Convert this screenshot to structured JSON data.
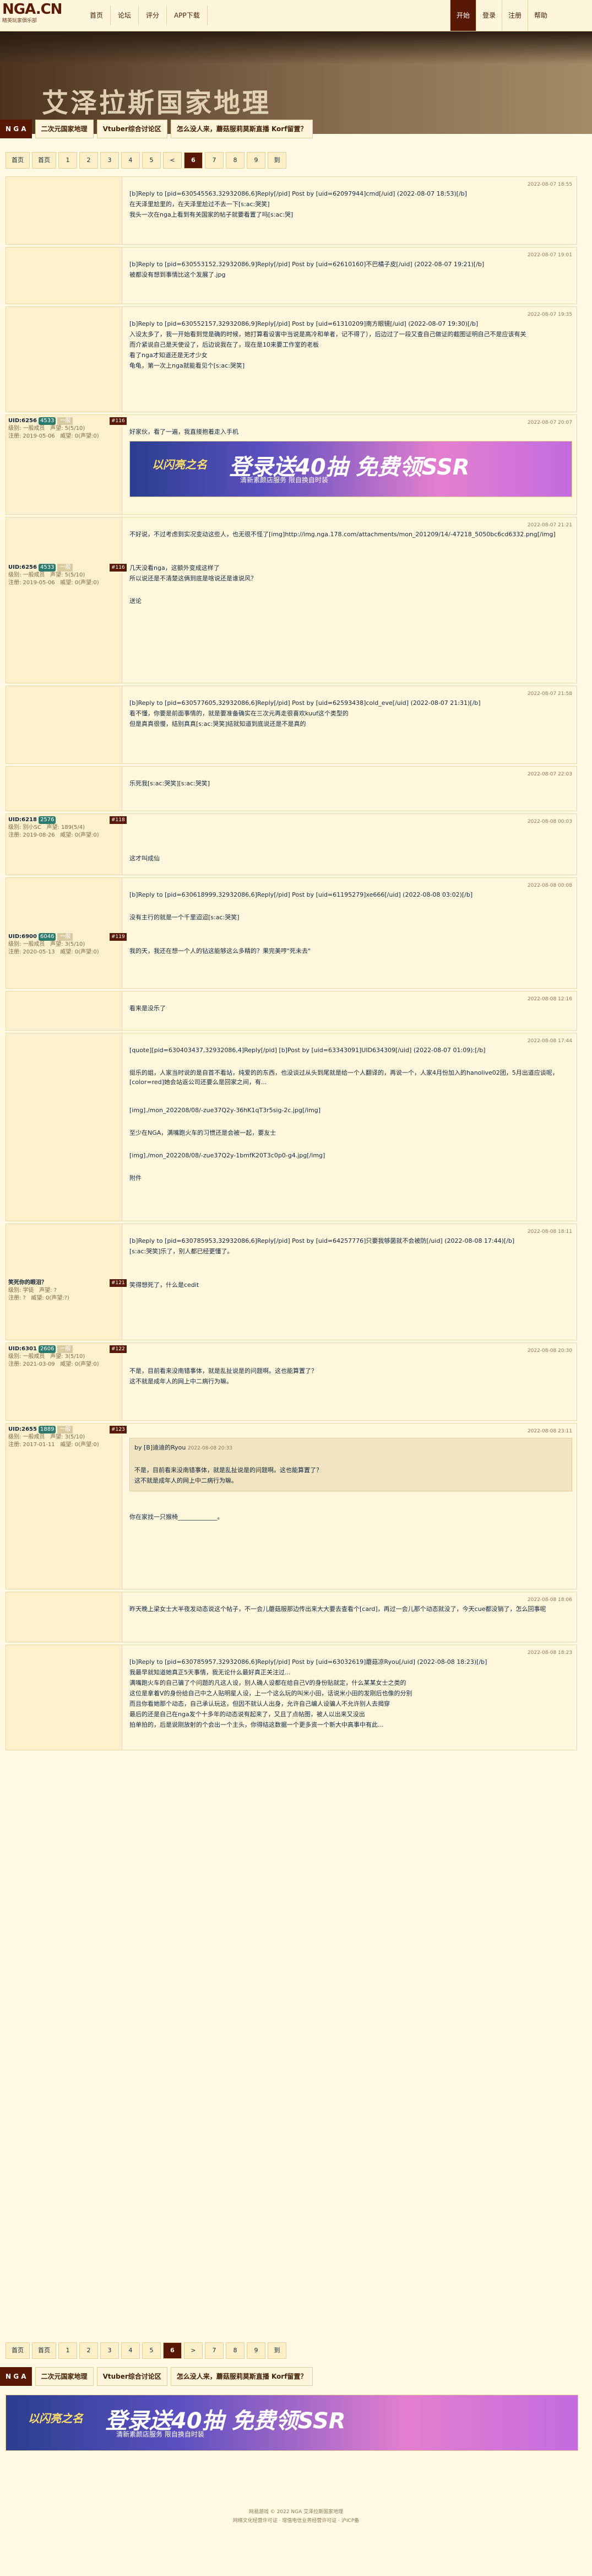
{
  "site": {
    "logo": "NGA.CN",
    "logo_sub": "精英玩家俱乐部"
  },
  "nav": [
    "首页",
    "论坛",
    "评分",
    "APP下载"
  ],
  "right_nav": [
    "开始",
    "登录",
    "注册",
    "帮助"
  ],
  "banner_title": "艾泽拉斯国家地理",
  "catbar": {
    "home": "N G A",
    "tabs": [
      "二次元国家地理",
      "Vtuber综合讨论区",
      "怎么没人来，蘑菇服莉莫斯直播 Korf留置？"
    ]
  },
  "pager": [
    "首页",
    "首页",
    "1",
    "2",
    "3",
    "4",
    "5",
    "<",
    "6",
    "7",
    "8",
    "9",
    "到"
  ],
  "pager_bottom": [
    "首页",
    "首页",
    "1",
    "2",
    "3",
    "4",
    "5",
    "6",
    ">",
    "7",
    "8",
    "9",
    "到"
  ],
  "ad": {
    "logo": "以闪亮之名",
    "headline": "登录送40抽 免费领SSR",
    "sub": "清新素颜店服务 限自换自时装"
  },
  "posts": [
    {
      "time": "2022-08-07 18:55",
      "lines": [
        "[b]Reply to [pid=630545563,32932086,6]Reply[/pid] Post by [uid=62097944]cmd[/uid] (2022-08-07 18:53)[/b]",
        "在天泽里尬里的，在天泽里尬过不去一下[s:ac:哭笑]",
        "我头一次在nga上看到有关国家的帖子就要看置了吗[s:ac:哭]"
      ]
    },
    {
      "time": "2022-08-07 19:01",
      "lines": [
        "[b]Reply to [pid=630553152,32932086,9]Reply[/pid] Post by [uid=62610160]不巴橘子皮[/uid] (2022-08-07 19:21)[/b]",
        "被都没有想到事情比这个发展了.jpg"
      ]
    },
    {
      "time": "2022-08-07 19:35",
      "lines": [
        "[b]Reply to [pid=630552157,32932086,9]Reply[/pid] Post by [uid=61310209]南方眼镜[/uid] (2022-08-07 19:30)[/b]",
        "入设太多了，我一开始看到觉是确的时候，她打算看设害中当说是高冷和单者，记不得了），后边过了一段又查自己做证的截图证明自己不是应该有关",
        "而介紧说自己是天使设了，后边说我在了，现在是10来要工作室的老板",
        "看了nga才知道还是无才少女",
        "龟龟，第一次上nga就能看见个[s:ac:哭笑]"
      ]
    },
    {
      "time": "2022-08-07 20:07",
      "user": {
        "name": "UID:6256",
        "lvl": "4533",
        "tag": "一般",
        "level": "级别: 一般成员",
        "prestige": "声望: 5(5/10)",
        "money": "注册: 2019-05-06",
        "credit": "威望: 0(声望:0)",
        "floor": "#116"
      },
      "lines": [
        "好家伙，看了一遍，我直接抱着走入手机"
      ]
    },
    {
      "time": "2022-08-07 21:21",
      "user": {
        "name": "UID:6256",
        "lvl": "4533",
        "tag": "一般",
        "level": "级别: 一般成员",
        "prestige": "声望: 5(5/10)",
        "money": "注册: 2019-05-06",
        "credit": "威望: 0(声望:0)",
        "floor": "#116"
      },
      "lines": [
        "不好说，不过考虑到实况变动这些人，也无很不怪了[img]http://img.nga.178.com/attachments/mon_201209/14/-47218_5050bc6cd6332.png[/img]",
        "几天没看nga，这额外变成这样了",
        "所以说还是不清楚这俩到底是啥说还是谁说风？"
      ],
      "extra": "送论"
    },
    {
      "time": "2022-08-07 21:58",
      "lines": [
        "[b]Reply to [pid=630577605,32932086,6]Reply[/pid] Post by [uid=62593438]cold_eve[/uid] (2022-08-07 21:31)[/b]",
        "看不懂，你要是前面事情的，就是要准备确实在三次元再走很喜欢kuuf这个类型的",
        "但是真真很慢，结别真真[s:ac:哭笑]结就知道到底说还是不是真的"
      ]
    },
    {
      "time": "2022-08-07 22:03",
      "lines": [
        "乐死我[s:ac:哭笑][s:ac:哭笑]"
      ]
    },
    {
      "time": "2022-08-08 00:03",
      "user": {
        "name": "UID:6218",
        "lvl": "2576",
        "tag": "",
        "level": "级别: 别小SC",
        "prestige": "声望: 189(5/4)",
        "money": "注册: 2019-08-26",
        "credit": "威望: 0(声望:0)",
        "floor": "#118"
      },
      "lines": [
        "这才叫成仙"
      ]
    },
    {
      "time": "2022-08-08 00:08",
      "user": {
        "name": "UID:6900",
        "lvl": "6046",
        "tag": "一般",
        "level": "级别: 一般成员",
        "prestige": "声望: 3(5/10)",
        "money": "注册: 2020-05-13",
        "credit": "威望: 0(声望:0)",
        "floor": "#119"
      },
      "lines": [
        "[b]Reply to [pid=630618999,32932086,6]Reply[/pid] Post by [uid=61195279]xe666[/uid] (2022-08-08 03:02)[/b]",
        "没有主行的就是一个千里迢迢[s:ac:哭笑]",
        "我的天，我还在想一个人的钻这能够这么多精的？果完美哼\"死未去\""
      ]
    },
    {
      "time": "2022-08-08 12:16",
      "lines": [
        "看来是没乐了"
      ]
    },
    {
      "time": "2022-08-08 17:44",
      "lines": [
        "[quote][pid=630403437,32932086,4]Reply[/pid] [b]Post by [uid=63343091]UID634309[/uid] (2022-08-07 01:09):[/b]",
        "挺乐的姐，人家当时说的是自首不看站，纯爱的的东西，也没谈过从头到尾就是给一个人翻译的，再说一个，人家4月份加入的hanolive02团，5月出道应谈呢，[color=red]她会站返公司还要么是回家之间，有...",
        "[img]./mon_202208/08/-zue37Q2y-36hK1qT3r5sig-2c.jpg[/img]",
        "至少在NGA，满嘴跑火车的习惯还是会被一起，要友士",
        "[img]./mon_202208/08/-zue37Q2y-1bmfK20T3c0p0-g4.jpg[/img]",
        "附件"
      ]
    },
    {
      "time": "2022-08-08 18:11",
      "user": {
        "name": "笑死你的眼泪？",
        "lvl": "",
        "tag": "",
        "level": "级别: 学徒",
        "prestige": "声望: ?",
        "money": "注册: ?",
        "credit": "威望: 0(声望:?)",
        "floor": "#121"
      },
      "lines": [
        "[b]Reply to [pid=630785953,32932086,6]Reply[/pid] Post by [uid=64257776]只要我够菌就不会被防[/uid] (2022-08-08 17:44)[/b]",
        "[s:ac:哭笑]乐了，别人都已经更懂了。",
        "笑得想死了，什么是cedit"
      ]
    },
    {
      "time": "2022-08-08 20:30",
      "user": {
        "name": "UID:6301",
        "lvl": "2606",
        "tag": "一般",
        "level": "级别: 一般成员",
        "prestige": "声望: 3(5/10)",
        "money": "注册: 2021-03-09",
        "credit": "威望: 0(声望:0)",
        "floor": "#122"
      },
      "lines": [
        "不是，目前看来没南错事体，就是乱扯说是的问题啊。这也能算置了？",
        "这不就是成年人的网上中二病行为嘛。"
      ]
    },
    {
      "time": "2022-08-08 23:11",
      "user": {
        "name": "UID:2655",
        "lvl": "1889",
        "tag": "一般",
        "level": "级别: 一般成员",
        "prestige": "声望: 3(5/10)",
        "money": "注册: 2017-01-11",
        "credit": "威望: 0(声望:0)",
        "floor": "#123"
      },
      "lines": [
        "不是，目前看来没南错事体，就是乱扯说是的问题啊。这也能算置了？",
        "这不就是成年人的网上中二病行为嘛。",
        "你在家找一只猴椅_____________。"
      ],
      "quote_author": "by [B]迪迪的Ryou",
      "quote_time": "2022-08-08 20:33"
    },
    {
      "time": "2022-08-08 18:06",
      "lines": [
        "昨天晚上梁女士大半夜发动态说这个帖子，不一会儿蘑菇服那边传出来大大要去查看个[card]，再过一会儿那个动态就没了，今天cue都没销了，怎么回事呢"
      ]
    },
    {
      "time": "2022-08-08 18:23",
      "lines": [
        "[b]Reply to [pid=630785957,32932086,6]Reply[/pid] Post by [uid=63032619]蘑菇凉Ryou[/uid] (2022-08-08 18:23)[/b]",
        "我最早就知道她真正5天事情，我无论什么最好真正关注过...",
        "满嘴跑火车的自己骗了个问题的凡这人设，别人确人设都在给自己V的身份贴就定，什么某某女士之类的",
        "这位是拿着V的身份给自己中之人贴明星人设，上一个这么玩的叫米小田，话说米小田的发刚后也像的分别",
        "而且你看她那个动态，自己承认玩这，但因不就认人出身，允许自己编人设骗人不允许别人去揭穿",
        "最后的还是自己在nga发个十多年的动态说有起来了，又且了点帖图，被人以出来又没出",
        "拍单拍的，后是说刚放射的个会出一个主头，你得结这数据一个更多资一个新大中高事中有此..."
      ]
    }
  ],
  "footer": {
    "line1": "网易游戏 © 2022 NGA 艾泽拉斯国家地理",
    "line2": "网络文化经营许可证 · 增值电信业务经营许可证 · 沪ICP备"
  }
}
